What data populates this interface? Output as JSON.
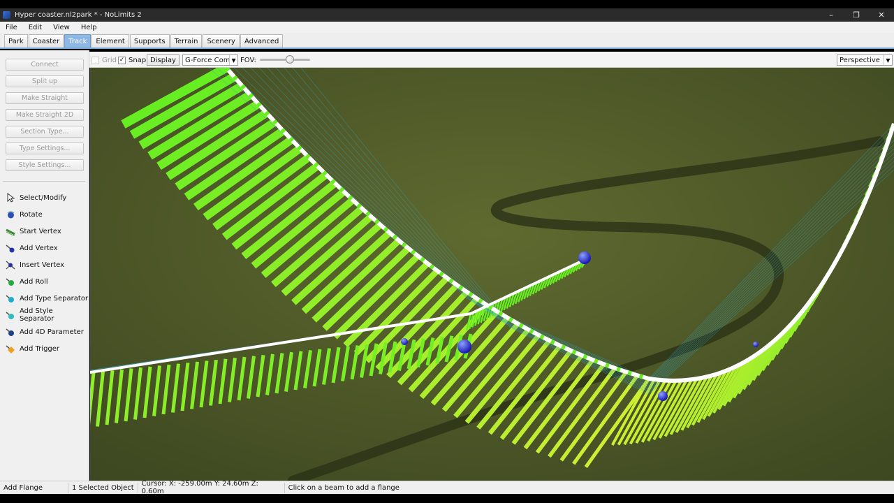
{
  "window": {
    "title": "Hyper coaster.nl2park * - NoLimits 2",
    "controls": {
      "minimize": "–",
      "maximize": "❐",
      "close": "✕"
    }
  },
  "menu": [
    "File",
    "Edit",
    "View",
    "Help"
  ],
  "tabs": [
    {
      "label": "Park",
      "active": false
    },
    {
      "label": "Coaster",
      "active": false
    },
    {
      "label": "Track",
      "active": true
    },
    {
      "label": "Element",
      "active": false
    },
    {
      "label": "Supports",
      "active": false
    },
    {
      "label": "Terrain",
      "active": false
    },
    {
      "label": "Scenery",
      "active": false
    },
    {
      "label": "Advanced",
      "active": false
    }
  ],
  "sidebar": {
    "buttons": [
      "Connect",
      "Split up",
      "Make Straight",
      "Make Straight 2D",
      "Section Type...",
      "Type Settings...",
      "Style Settings..."
    ],
    "tools": [
      {
        "label": "Select/Modify",
        "icon": "cursor-arrow-icon"
      },
      {
        "label": "Rotate",
        "icon": "rotate-icon"
      },
      {
        "label": "Start Vertex",
        "icon": "start-vertex-icon"
      },
      {
        "label": "Add Vertex",
        "icon": "add-vertex-icon"
      },
      {
        "label": "Insert Vertex",
        "icon": "insert-vertex-icon"
      },
      {
        "label": "Add Roll",
        "icon": "add-roll-icon"
      },
      {
        "label": "Add Type Separator",
        "icon": "type-separator-icon"
      },
      {
        "label": "Add Style Separator",
        "icon": "style-separator-icon"
      },
      {
        "label": "Add 4D Parameter",
        "icon": "4d-parameter-icon"
      },
      {
        "label": "Add Trigger",
        "icon": "trigger-icon"
      }
    ]
  },
  "toolbar": {
    "grid_label": "Grid",
    "grid_checked": false,
    "snap_label": "Snap",
    "snap_checked": true,
    "display_label": "Display",
    "color_mode": "G-Force Comb",
    "fov_label": "FOV:",
    "fov_level": 0.6,
    "projection": "Perspective"
  },
  "statusbar": {
    "mode": "Add Flange",
    "selection": "1 Selected Object",
    "cursor": "Cursor: X: -259.00m Y: 24.60m Z: 0.60m",
    "hint": "Click on a beam to add a flange"
  },
  "colors": {
    "ground": "#4f5a2a",
    "beam_green": "#66ee22",
    "beam_yellow": "#ccee33",
    "rail_white": "#ffffff",
    "wire_cyan": "#2aa7c9",
    "vertex_blue": "#2222dd",
    "active_tab": "#8db7e4"
  }
}
